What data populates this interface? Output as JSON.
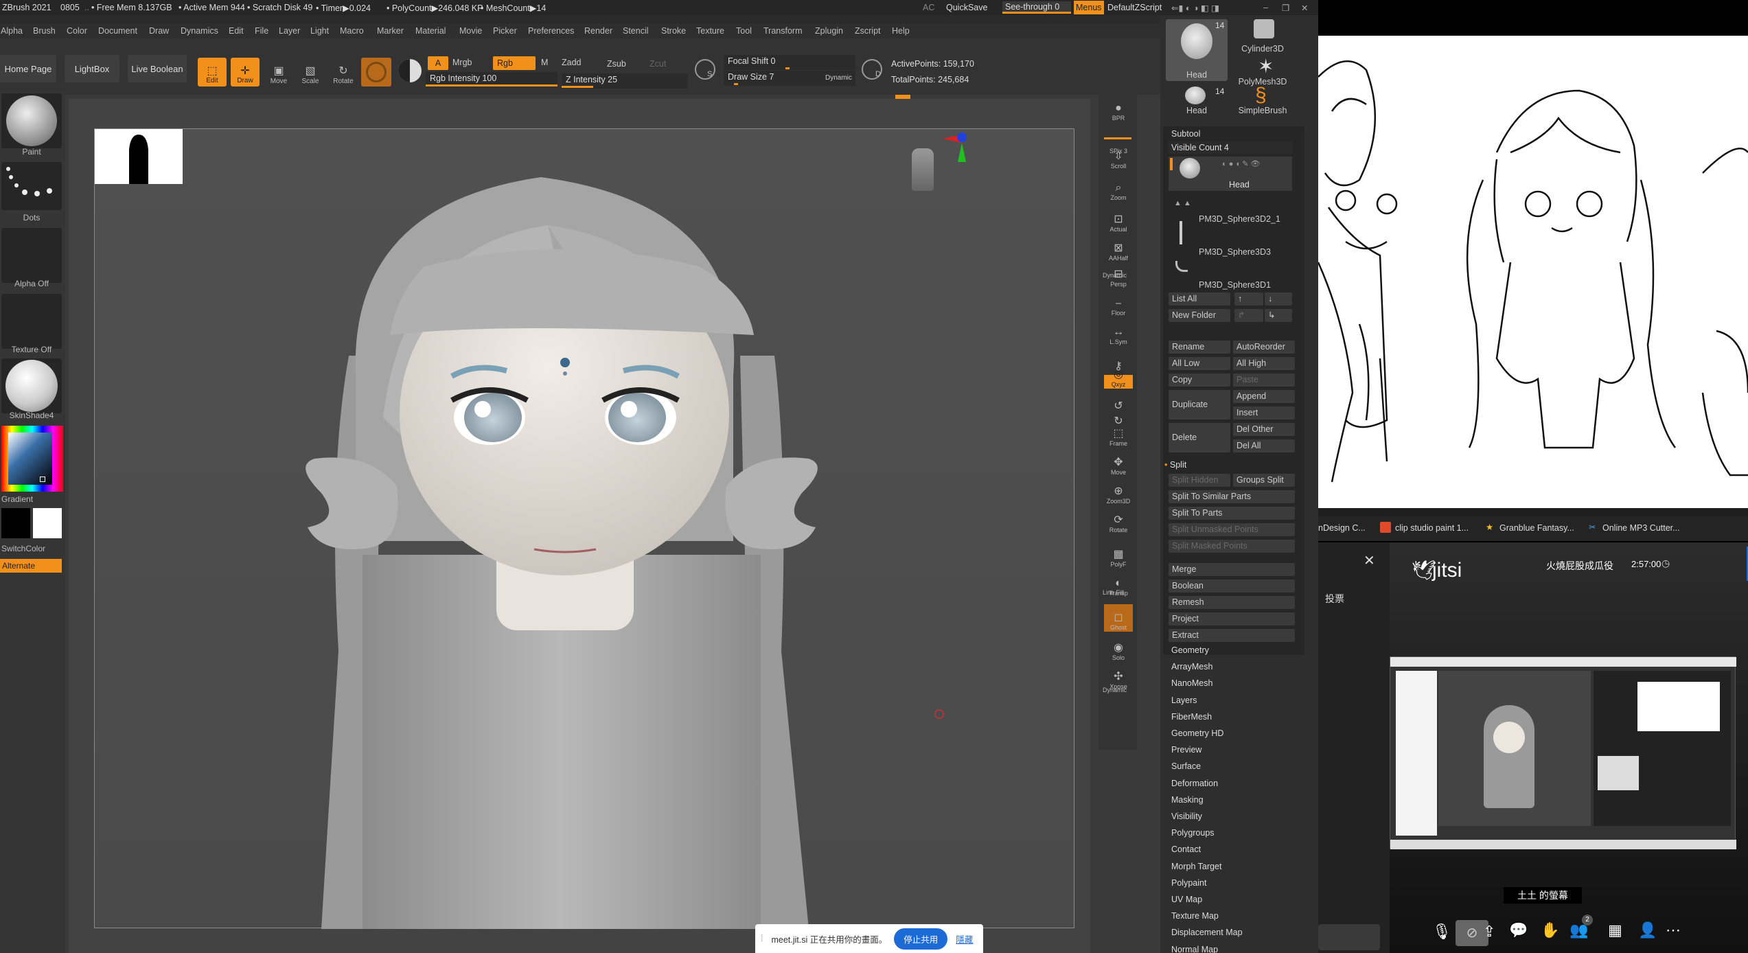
{
  "zbrush": {
    "title_bar": {
      "app": "ZBrush 2021",
      "build": "0805",
      "free_mem": "• Free Mem 8.137GB",
      "active_mem": "• Active Mem 944",
      "scratch_disk": "• Scratch Disk 49",
      "timer": "• Timer▶0.024",
      "polycount": "• PolyCount▶246.048 KP",
      "meshcount": "• MeshCount▶14",
      "ac": "AC",
      "quicksave": "QuickSave",
      "see_through": "See-through",
      "see_through_value": "0",
      "menus": "Menus",
      "default_zscript": "DefaultZScript"
    },
    "menu": [
      "Alpha",
      "Brush",
      "Color",
      "Document",
      "Draw",
      "Dynamics",
      "Edit",
      "File",
      "Layer",
      "Light",
      "Macro",
      "Marker",
      "Material",
      "Movie",
      "Picker",
      "Preferences",
      "Render",
      "Stencil",
      "Stroke",
      "Texture",
      "Tool",
      "Transform",
      "Zplugin",
      "Zscript",
      "Help"
    ],
    "toolbar": {
      "home_page": "Home Page",
      "lightbox": "LightBox",
      "live_boolean": "Live Boolean",
      "edit": "Edit",
      "draw": "Draw",
      "move": "Move",
      "scale": "Scale",
      "rotate": "Rotate",
      "a": "A",
      "mrgb": "Mrgb",
      "rgb": "Rgb",
      "m": "M",
      "zadd": "Zadd",
      "zsub": "Zsub",
      "zcut": "Zcut",
      "rgb_intensity": "Rgb Intensity 100",
      "z_intensity": "Z Intensity 25",
      "focal_shift": "Focal Shift 0",
      "draw_size": "Draw Size 7",
      "dynamic": "Dynamic",
      "s": "S",
      "d": "D",
      "active_points": "ActivePoints: 159,170",
      "total_points": "TotalPoints: 245,684",
      "rgb_intensity_level": 1.0,
      "z_intensity_level": 0.25
    },
    "left_shelf": {
      "paint": "Paint",
      "dots": "Dots",
      "alpha_off": "Alpha Off",
      "texture_off": "Texture Off",
      "material": "SkinShade4",
      "gradient": "Gradient",
      "switch_color": "SwitchColor",
      "alternate": "Alternate"
    },
    "right_shelf": [
      "BPR",
      "SPix 3",
      "Scroll",
      "Zoom",
      "Actual",
      "AAHalf",
      "Persp",
      "Floor",
      "L.Sym",
      "",
      "Qxyz",
      "",
      "",
      "Frame",
      "Move",
      "Zoom3D",
      "Rotate",
      "PolyF",
      "Transp",
      "Ghost",
      "Solo",
      "Xpose"
    ],
    "right_shelf_labels": {
      "dynamic": "Dynamic",
      "line_fill": "Line Fill"
    },
    "tool_thumbs": {
      "head_top": "Head",
      "head_top_count": "14",
      "cylinder": "Cylinder3D",
      "polymesh": "PolyMesh3D",
      "head_bottom": "Head",
      "head_bottom_count": "14",
      "simplebrush": "SimpleBrush"
    },
    "subtool": {
      "title": "Subtool",
      "visible_count": "Visible Count 4",
      "items": [
        "Head",
        "PM3D_Sphere3D2_1",
        "PM3D_Sphere3D3",
        "PM3D_Sphere3D1"
      ],
      "list_all": "List All",
      "new_folder": "New Folder",
      "rename": "Rename",
      "autoreorder": "AutoReorder",
      "all_low": "All Low",
      "all_high": "All High",
      "copy": "Copy",
      "paste": "Paste",
      "append": "Append",
      "duplicate": "Duplicate",
      "insert": "Insert",
      "delete": "Delete",
      "del_other": "Del Other",
      "del_all": "Del All",
      "split": "Split",
      "split_hidden": "Split Hidden",
      "groups_split": "Groups Split",
      "split_similar": "Split To Similar Parts",
      "split_parts": "Split To Parts",
      "split_unmasked": "Split Unmasked Points",
      "split_masked": "Split Masked Points",
      "merge": "Merge",
      "boolean": "Boolean",
      "remesh": "Remesh",
      "project": "Project",
      "extract": "Extract"
    },
    "palettes": [
      "Geometry",
      "ArrayMesh",
      "NanoMesh",
      "Layers",
      "FiberMesh",
      "Geometry HD",
      "Preview",
      "Surface",
      "Deformation",
      "Masking",
      "Visibility",
      "Polygroups",
      "Contact",
      "Morph Target",
      "Polypaint",
      "UV Map",
      "Texture Map",
      "Displacement Map",
      "Normal Map"
    ]
  },
  "browser": {
    "bookmarks": [
      "nDesign C...",
      "clip studio paint 1...",
      "Granblue Fantasy...",
      "Online MP3 Cutter..."
    ]
  },
  "jitsi": {
    "brand": "jitsi",
    "poll": "投票",
    "room": "火燒屁股成瓜役",
    "timer": "2:57:00",
    "screen_label": "土土 的螢幕",
    "participants": "2"
  },
  "share_bar": {
    "message": "meet.jit.si 正在共用你的畫面。",
    "stop": "停止共用",
    "hide": "隱藏"
  },
  "colors": {
    "accent": "#f2901c",
    "panel": "#2e2e2e",
    "canvas": "#4a4a4a",
    "jitsi_blue": "#1c6ad6"
  }
}
